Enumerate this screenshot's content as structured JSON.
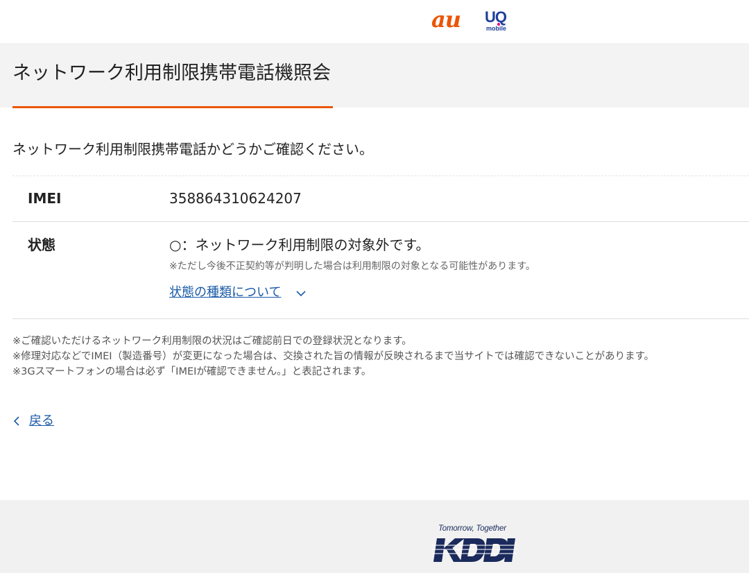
{
  "header": {
    "logos": [
      {
        "name": "au",
        "text": "au",
        "color": "#eb5505"
      },
      {
        "name": "UQ mobile",
        "text": "UQ",
        "subtext": "mobile",
        "color": "#1e3f9b"
      }
    ]
  },
  "page": {
    "title": "ネットワーク利用制限携帯電話機照会",
    "accent_color": "#eb5505",
    "intro": "ネットワーク利用制限携帯電話かどうかご確認ください。"
  },
  "result": {
    "imei_label": "IMEI",
    "imei_value": "358864310624207",
    "status_label": "状態",
    "status_value": "○：ネットワーク利用制限の対象外です。",
    "status_note": "※ただし今後不正契約等が判明した場合は利用制限の対象となる可能性があります。",
    "status_types_link": "状態の種類について",
    "status_types_icon": "chevron-down-icon"
  },
  "footnotes": [
    "※ご確認いただけるネットワーク利用制限の状況はご確認前日での登録状況となります。",
    "※修理対応などでIMEI（製造番号）が変更になった場合は、交換された旨の情報が反映されるまで当サイトでは確認できないことがあります。",
    "※3Gスマートフォンの場合は必ず「IMEIが確認できません。」と表記されます。"
  ],
  "navigation": {
    "back_label": "戻る",
    "back_icon": "chevron-left-icon",
    "link_color": "#1a5aa8"
  },
  "footer": {
    "tagline": "Tomorrow, Together",
    "logo": "KDDI",
    "logo_color": "#1a2a5c"
  }
}
